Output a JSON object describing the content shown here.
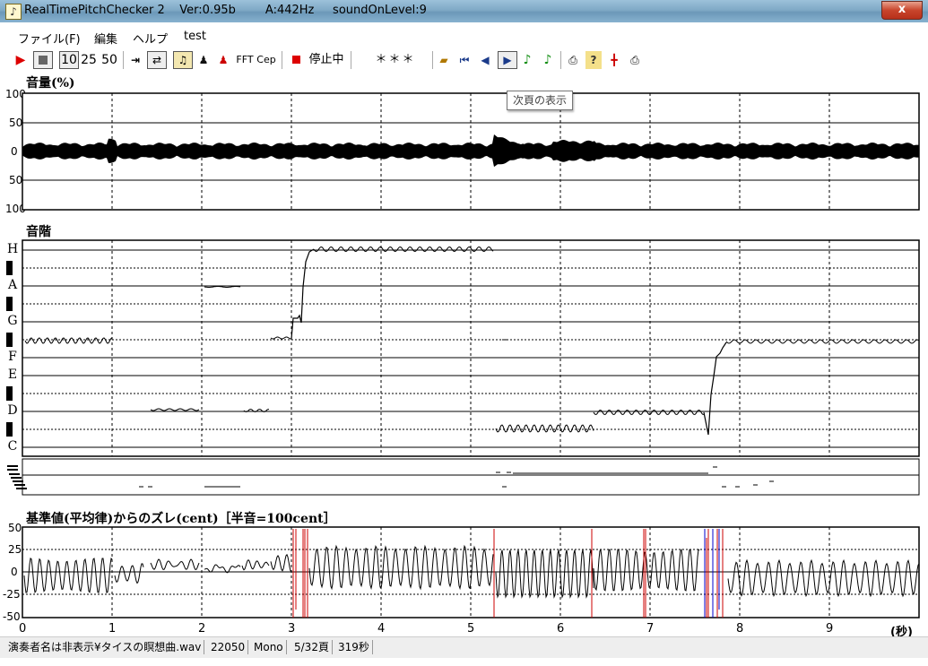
{
  "window": {
    "title": "RealTimePitchChecker 2    Ver:0.95b        A:442Hz     soundOnLevel:9",
    "close_label": "x"
  },
  "menu": [
    "ファイル(F)",
    "編集",
    "ヘルプ",
    "test"
  ],
  "toolbar": {
    "speed_options": [
      "10",
      "25",
      "50"
    ],
    "fft_label": "FFT",
    "cep_label": "Cep",
    "status_label": "停止中",
    "indicator_text": "＊＊＊"
  },
  "tooltip": "次頁の表示",
  "volume_panel": {
    "title": "音量(%)",
    "y_ticks": [
      "100",
      "50",
      "0",
      "50",
      "100"
    ]
  },
  "scale_panel": {
    "title": "音階",
    "notes": [
      "H",
      "A",
      "G",
      "F",
      "E",
      "D",
      "C"
    ]
  },
  "deviation_panel": {
    "title": "基準値(平均律)からのズレ(cent)［半音=100cent］",
    "y_ticks": [
      "50",
      "25",
      "0",
      "-25",
      "-50"
    ]
  },
  "x_axis": {
    "ticks": [
      "0",
      "1",
      "2",
      "3",
      "4",
      "5",
      "6",
      "7",
      "8",
      "9"
    ],
    "unit": "(秒)"
  },
  "statusbar": {
    "file": "演奏者名は非表示¥タイスの瞑想曲.wav",
    "rate": "22050",
    "channels": "Mono",
    "page": "5/32頁",
    "duration": "319秒"
  },
  "colors": {
    "title_bar": "#7fa9c6",
    "close_button": "#c8452c",
    "trace": "#000000",
    "marker_red": "#cc0000",
    "marker_blue": "#0000cc"
  }
}
